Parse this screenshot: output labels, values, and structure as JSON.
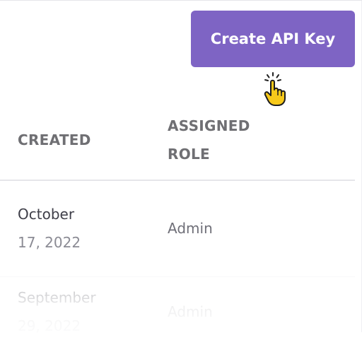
{
  "toolbar": {
    "create_label": "Create API Key",
    "accent_color": "#7e64c4",
    "cursor_icon": "pointer-hand-click-icon"
  },
  "table": {
    "columns": [
      "CREATED",
      "ASSIGNED ROLE"
    ],
    "header_created": "CREATED",
    "header_role_line1": "ASSIGNED",
    "header_role_line2": "ROLE",
    "rows": [
      {
        "created_line1": "October",
        "created_line2": "17, 2022",
        "role": "Admin"
      },
      {
        "created_line1": "September",
        "created_line2": "29, 2022",
        "role": "Admin"
      }
    ]
  }
}
